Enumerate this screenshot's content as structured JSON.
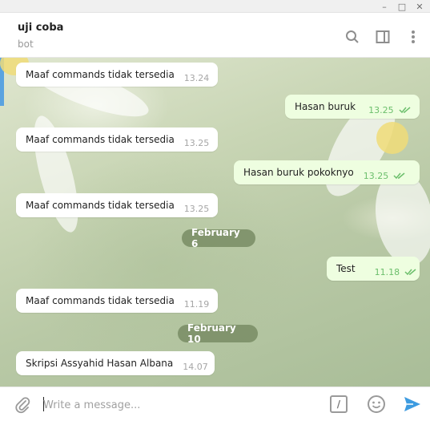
{
  "window": {
    "minimize": "–",
    "maximize": "□",
    "close": "✕"
  },
  "header": {
    "title": "uji coba",
    "subtitle": "bot",
    "icons": [
      "search-icon",
      "sidebar-toggle-icon",
      "more-vertical-icon"
    ]
  },
  "messages": [
    {
      "dir": "in",
      "text": "Maaf commands tidak tersedia",
      "time": "13.24"
    },
    {
      "dir": "out",
      "text": "Hasan buruk",
      "time": "13.25"
    },
    {
      "dir": "in",
      "text": "Maaf commands tidak tersedia",
      "time": "13.25"
    },
    {
      "dir": "out",
      "text": "Hasan buruk pokoknyo",
      "time": "13.25"
    },
    {
      "dir": "in",
      "text": "Maaf commands tidak tersedia",
      "time": "13.25"
    },
    {
      "dir": "date",
      "text": "February 6"
    },
    {
      "dir": "out",
      "text": "Test",
      "time": "11.18"
    },
    {
      "dir": "in",
      "text": "Maaf commands tidak tersedia",
      "time": "11.19"
    },
    {
      "dir": "date",
      "text": "February 10"
    },
    {
      "dir": "in",
      "text": "Skripsi Assyahid Hasan Albana",
      "time": "14.07"
    }
  ],
  "input": {
    "placeholder": "Write a message...",
    "commands_label": "/"
  },
  "colors": {
    "accent": "#5aa3e0",
    "read_ticks": "#6cbf6c",
    "send": "#3d9be0"
  }
}
